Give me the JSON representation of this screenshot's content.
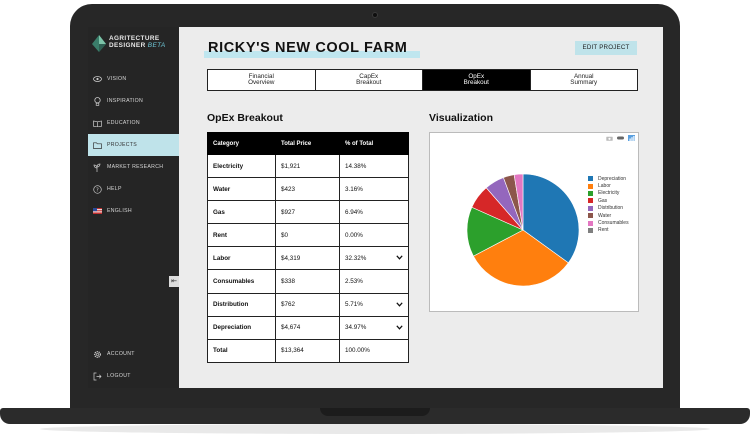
{
  "app": {
    "logo_line1": "AGRITECTURE",
    "logo_line2": "DESIGNER",
    "logo_beta": "BETA"
  },
  "sidebar": {
    "items": [
      {
        "label": "VISION",
        "icon": "eye-icon"
      },
      {
        "label": "INSPIRATION",
        "icon": "lightbulb-icon"
      },
      {
        "label": "EDUCATION",
        "icon": "book-icon"
      },
      {
        "label": "PROJECTS",
        "icon": "folder-icon",
        "active": true
      },
      {
        "label": "MARKET RESEARCH",
        "icon": "plant-icon"
      },
      {
        "label": "HELP",
        "icon": "question-icon"
      },
      {
        "label": "ENGLISH",
        "icon": "us-flag-icon"
      }
    ],
    "bottom": [
      {
        "label": "ACCOUNT",
        "icon": "gear-icon"
      },
      {
        "label": "LOGOUT",
        "icon": "logout-icon"
      }
    ],
    "collapse_glyph": "⇤"
  },
  "header": {
    "title": "RICKY'S NEW COOL FARM",
    "edit_button": "EDIT PROJECT"
  },
  "tabs": [
    {
      "line1": "Financial",
      "line2": "Overview"
    },
    {
      "line1": "CapEx",
      "line2": "Breakout"
    },
    {
      "line1": "OpEx",
      "line2": "Breakout",
      "active": true
    },
    {
      "line1": "Annual",
      "line2": "Summary"
    }
  ],
  "opex": {
    "heading": "OpEx Breakout",
    "columns": [
      "Category",
      "Total Price",
      "% of Total"
    ],
    "rows": [
      {
        "category": "Electricity",
        "price": "$1,921",
        "pct": "14.38%",
        "expandable": false
      },
      {
        "category": "Water",
        "price": "$423",
        "pct": "3.16%",
        "expandable": false
      },
      {
        "category": "Gas",
        "price": "$927",
        "pct": "6.94%",
        "expandable": false
      },
      {
        "category": "Rent",
        "price": "$0",
        "pct": "0.00%",
        "expandable": false
      },
      {
        "category": "Labor",
        "price": "$4,319",
        "pct": "32.32%",
        "expandable": true
      },
      {
        "category": "Consumables",
        "price": "$338",
        "pct": "2.53%",
        "expandable": false
      },
      {
        "category": "Distribution",
        "price": "$762",
        "pct": "5.71%",
        "expandable": true
      },
      {
        "category": "Depreciation",
        "price": "$4,674",
        "pct": "34.97%",
        "expandable": true
      },
      {
        "category": "Total",
        "price": "$13,364",
        "pct": "100.00%",
        "expandable": false
      }
    ]
  },
  "visualization": {
    "heading": "Visualization",
    "toolbar_icons": [
      "camera-icon",
      "zoom-icon",
      "chart-icon"
    ]
  },
  "chart_data": {
    "type": "pie",
    "categories": [
      "Depreciation",
      "Labor",
      "Electricity",
      "Gas",
      "Distribution",
      "Water",
      "Consumables",
      "Rent"
    ],
    "values": [
      34.97,
      32.32,
      14.38,
      6.94,
      5.71,
      3.16,
      2.53,
      0.0
    ],
    "colors": [
      "#1f77b4",
      "#ff7f0e",
      "#2ca02c",
      "#d62728",
      "#9467bd",
      "#8c564b",
      "#e377c2",
      "#7f7f7f"
    ],
    "legend_position": "right"
  }
}
